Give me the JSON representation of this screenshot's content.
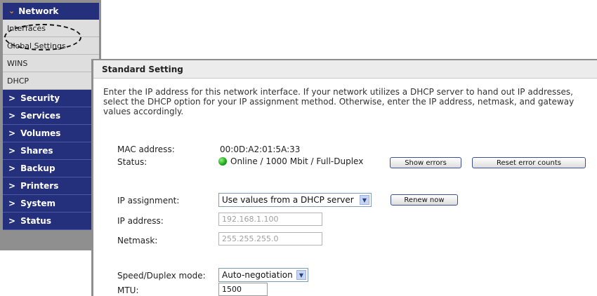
{
  "sidebar": {
    "header": "Network",
    "sub_items": [
      "Interfaces",
      "Global Settings",
      "WINS",
      "DHCP"
    ],
    "items": [
      "Security",
      "Services",
      "Volumes",
      "Shares",
      "Backup",
      "Printers",
      "System",
      "Status"
    ]
  },
  "main": {
    "title": "Standard Setting",
    "description": "Enter the IP address for this network interface. If your network utilizes a DHCP server to hand out IP addresses, select the DHCP option for your IP assignment method. Otherwise, enter the IP address, netmask, and gateway values accordingly.",
    "mac_label": "MAC address:",
    "mac_value": "00:0D:A2:01:5A:33",
    "status_label": "Status:",
    "status_value": "Online / 1000 Mbit / Full-Duplex",
    "show_errors": "Show errors",
    "reset_errors": "Reset error counts",
    "ip_assignment_label": "IP assignment:",
    "ip_assignment_value": "Use values from a DHCP server",
    "renew_now": "Renew now",
    "ip_address_label": "IP address:",
    "ip_address_value": "192.168.1.100",
    "netmask_label": "Netmask:",
    "netmask_value": "255.255.255.0",
    "speed_label": "Speed/Duplex mode:",
    "speed_value": "Auto-negotiation",
    "mtu_label": "MTU:",
    "mtu_value": "1500"
  },
  "colors": {
    "nav_blue": "#24307c",
    "accent_orange": "#f29a1c",
    "status_green": "#1aa51a"
  }
}
